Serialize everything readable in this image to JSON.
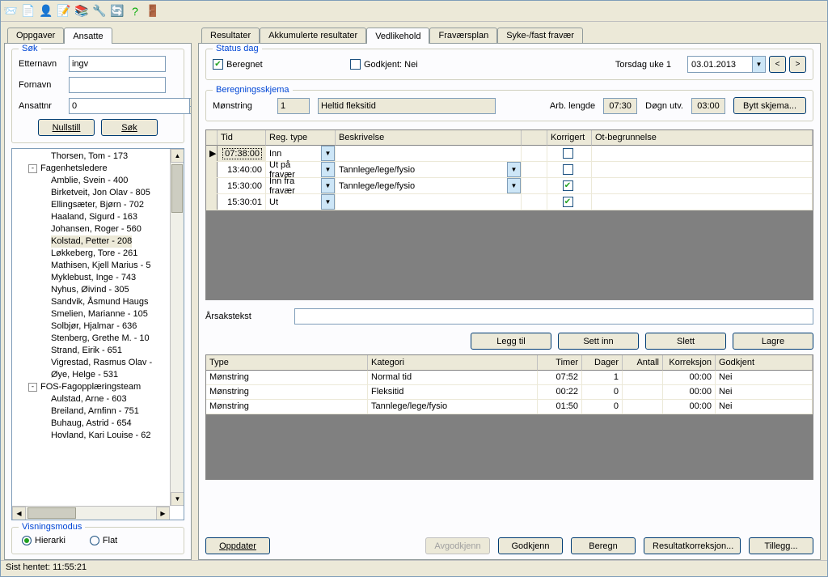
{
  "toolbar_icons": [
    "mail-icon",
    "new-icon",
    "user-icon",
    "edit-form-icon",
    "book-icon",
    "wrench-icon",
    "refresh-icon",
    "help-icon",
    "exit-icon"
  ],
  "left_tabs": {
    "items": [
      "Oppgaver",
      "Ansatte"
    ],
    "active": 1
  },
  "search": {
    "legend": "Søk",
    "etternavn_label": "Etternavn",
    "etternavn_value": "ingv",
    "fornavn_label": "Fornavn",
    "fornavn_value": "",
    "ansattnr_label": "Ansattnr",
    "ansattnr_value": "0",
    "nullstill": "Nullstill",
    "sok": "Søk"
  },
  "tree": {
    "items": [
      {
        "level": 2,
        "text": "Thorsen, Tom - 173"
      },
      {
        "level": 1,
        "text": "Fagenhetsledere",
        "exp": "-"
      },
      {
        "level": 2,
        "text": "Amblie, Svein - 400"
      },
      {
        "level": 2,
        "text": "Birketveit, Jon Olav - 805"
      },
      {
        "level": 2,
        "text": "Ellingsæter, Bjørn - 702"
      },
      {
        "level": 2,
        "text": "Haaland, Sigurd - 163"
      },
      {
        "level": 2,
        "text": "Johansen, Roger - 560"
      },
      {
        "level": 2,
        "text": "Kolstad, Petter - 208",
        "sel": true
      },
      {
        "level": 2,
        "text": "Løkkeberg, Tore - 261"
      },
      {
        "level": 2,
        "text": "Mathisen, Kjell Marius - 5"
      },
      {
        "level": 2,
        "text": "Myklebust, Inge - 743"
      },
      {
        "level": 2,
        "text": "Nyhus, Øivind - 305"
      },
      {
        "level": 2,
        "text": "Sandvik, Åsmund Haugs"
      },
      {
        "level": 2,
        "text": "Smelien, Marianne - 105"
      },
      {
        "level": 2,
        "text": "Solbjør, Hjalmar - 636"
      },
      {
        "level": 2,
        "text": "Stenberg, Grethe M. - 10"
      },
      {
        "level": 2,
        "text": "Strand, Eirik - 651"
      },
      {
        "level": 2,
        "text": "Vigrestad, Rasmus Olav -"
      },
      {
        "level": 2,
        "text": "Øye, Helge - 531"
      },
      {
        "level": 1,
        "text": "FOS-Fagopplæringsteam",
        "exp": "-"
      },
      {
        "level": 2,
        "text": "Aulstad, Arne - 603"
      },
      {
        "level": 2,
        "text": "Breiland, Arnfinn - 751"
      },
      {
        "level": 2,
        "text": "Buhaug, Astrid - 654"
      },
      {
        "level": 2,
        "text": "Hovland, Kari Louise - 62"
      }
    ]
  },
  "visning": {
    "legend": "Visningsmodus",
    "hierarki": "Hierarki",
    "flat": "Flat"
  },
  "statusbar": "Sist hentet: 11:55:21",
  "main_tabs": {
    "items": [
      "Resultater",
      "Akkumulerte resultater",
      "Vedlikehold",
      "Fraværsplan",
      "Syke-/fast fravær"
    ],
    "active": 2
  },
  "status_dag": {
    "legend": "Status dag",
    "beregnet": "Beregnet",
    "beregnet_checked": true,
    "godkjent": "Godkjent: Nei",
    "godkjent_checked": false,
    "dayname": "Torsdag uke 1",
    "date": "03.01.2013"
  },
  "bereg": {
    "legend": "Beregningsskjema",
    "monstring_label": "Mønstring",
    "monstring_val": "1",
    "desc": "Heltid fleksitid",
    "arb_label": "Arb. lengde",
    "arb_val": "07:30",
    "dogn_label": "Døgn utv.",
    "dogn_val": "03:00",
    "bytt": "Bytt skjema..."
  },
  "grid": {
    "headers": {
      "tid": "Tid",
      "reg": "Reg. type",
      "besk": "Beskrivelse",
      "kor": "Korrigert",
      "ot": "Ot-begrunnelse"
    },
    "rows": [
      {
        "tid": "07:38:00",
        "reg": "Inn",
        "besk": "",
        "kor": false,
        "sel": true,
        "combo2": false
      },
      {
        "tid": "13:40:00",
        "reg": "Ut på fravær",
        "besk": "Tannlege/lege/fysio",
        "kor": false,
        "combo2": true
      },
      {
        "tid": "15:30:00",
        "reg": "Inn fra fravær",
        "besk": "Tannlege/lege/fysio",
        "kor": true,
        "combo2": true
      },
      {
        "tid": "15:30:01",
        "reg": "Ut",
        "besk": "",
        "kor": true,
        "combo2": false
      }
    ]
  },
  "arsak": {
    "label": "Årsakstekst",
    "value": ""
  },
  "actions": {
    "legg": "Legg til",
    "sett": "Sett inn",
    "slett": "Slett",
    "lagre": "Lagre"
  },
  "grid2": {
    "headers": {
      "type": "Type",
      "kat": "Kategori",
      "timer": "Timer",
      "dager": "Dager",
      "antall": "Antall",
      "korr": "Korreksjon",
      "god": "Godkjent"
    },
    "rows": [
      {
        "type": "Mønstring",
        "kat": "Normal tid",
        "timer": "07:52",
        "dager": "1",
        "antall": "",
        "korr": "00:00",
        "god": "Nei"
      },
      {
        "type": "Mønstring",
        "kat": "Fleksitid",
        "timer": "00:22",
        "dager": "0",
        "antall": "",
        "korr": "00:00",
        "god": "Nei"
      },
      {
        "type": "Mønstring",
        "kat": "Tannlege/lege/fysio",
        "timer": "01:50",
        "dager": "0",
        "antall": "",
        "korr": "00:00",
        "god": "Nei"
      }
    ]
  },
  "bottom": {
    "oppdater": "Oppdater",
    "avgodkjenn": "Avgodkjenn",
    "godkjenn": "Godkjenn",
    "beregn": "Beregn",
    "resultat": "Resultatkorreksjon...",
    "tillegg": "Tillegg..."
  }
}
